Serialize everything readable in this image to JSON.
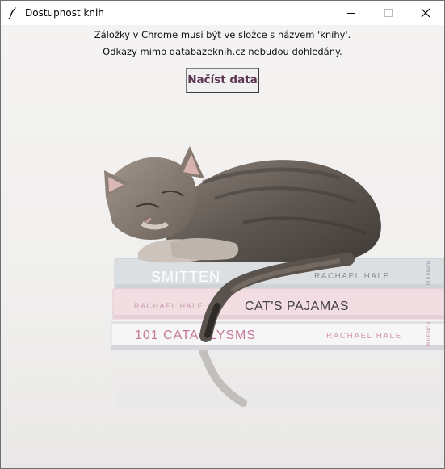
{
  "window": {
    "title": "Dostupnost knih",
    "controls": {
      "minimize": "minimize-icon",
      "maximize": "maximize-icon",
      "close": "close-icon"
    }
  },
  "info": {
    "line1": "Záložky v Chrome musí být ve složce s názvem 'knihy'.",
    "line2": "Odkazy mimo databazeknih.cz nebudou dohledány."
  },
  "load_button": {
    "label": "Načíst data"
  },
  "background_image": {
    "books": [
      {
        "title": "SMITTEN",
        "author": "RACHAEL HALE",
        "publisher": "BULFINCH"
      },
      {
        "title": "CAT'S PAJAMAS",
        "author": "RACHAEL HALE"
      },
      {
        "title": "101 CATACLYSMS",
        "author": "RACHAEL HALE",
        "publisher": "BULFINCH"
      }
    ]
  },
  "colors": {
    "button_text": "#5c3650",
    "background": "#f2f1f0"
  }
}
